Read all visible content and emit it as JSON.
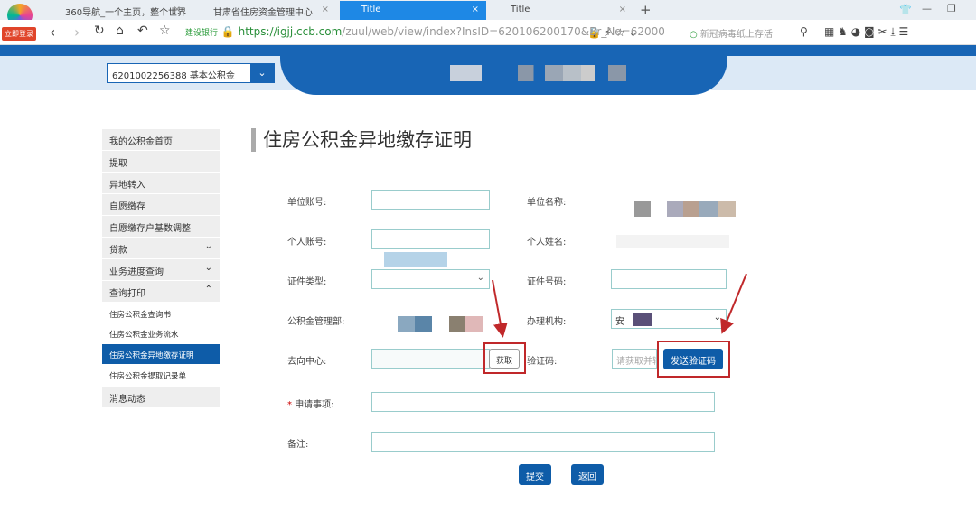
{
  "browser": {
    "login_badge": "立即登录",
    "tabs": [
      {
        "label": "360导航_一个主页，整个世界"
      },
      {
        "label": "甘肃省住房资金管理中心"
      },
      {
        "label": "Title"
      },
      {
        "label": "Title"
      }
    ],
    "url_badge": "建设银行",
    "url_host": "https://igjj.ccb.com",
    "url_path": "/zuul/web/view/index?InsID=620106200170&Br_No=620000",
    "search_placeholder": "新冠病毒纸上存活"
  },
  "header": {
    "account_select": "6201002256388  基本公积金"
  },
  "sidebar": {
    "items": [
      {
        "label": "我的公积金首页"
      },
      {
        "label": "提取"
      },
      {
        "label": "异地转入"
      },
      {
        "label": "自愿缴存"
      },
      {
        "label": "自愿缴存户基数调整"
      },
      {
        "label": "贷款"
      },
      {
        "label": "业务进度查询"
      },
      {
        "label": "查询打印"
      }
    ],
    "sub_items": [
      {
        "label": "住房公积金查询书"
      },
      {
        "label": "住房公积金业务流水"
      },
      {
        "label": "住房公积金异地缴存证明"
      },
      {
        "label": "住房公积金提取记录单"
      }
    ],
    "last": {
      "label": "消息动态"
    }
  },
  "page": {
    "title": "住房公积金异地缴存证明"
  },
  "form": {
    "unit_account": "单位账号:",
    "unit_name": "单位名称:",
    "personal_account": "个人账号:",
    "personal_name": "个人姓名:",
    "id_type": "证件类型:",
    "id_number": "证件号码:",
    "fund_dept": "公积金管理部:",
    "handling_org": "办理机构:",
    "handling_org_value": "安",
    "dest_center": "去向中心:",
    "fetch_button": "获取",
    "verify_code": "验证码:",
    "verify_placeholder": "请获取并输",
    "send_code_button": "发送验证码",
    "required_mark": "*",
    "application": "申请事项:",
    "remark": "备注:",
    "submit_button": "提交",
    "back_button": "返回"
  }
}
